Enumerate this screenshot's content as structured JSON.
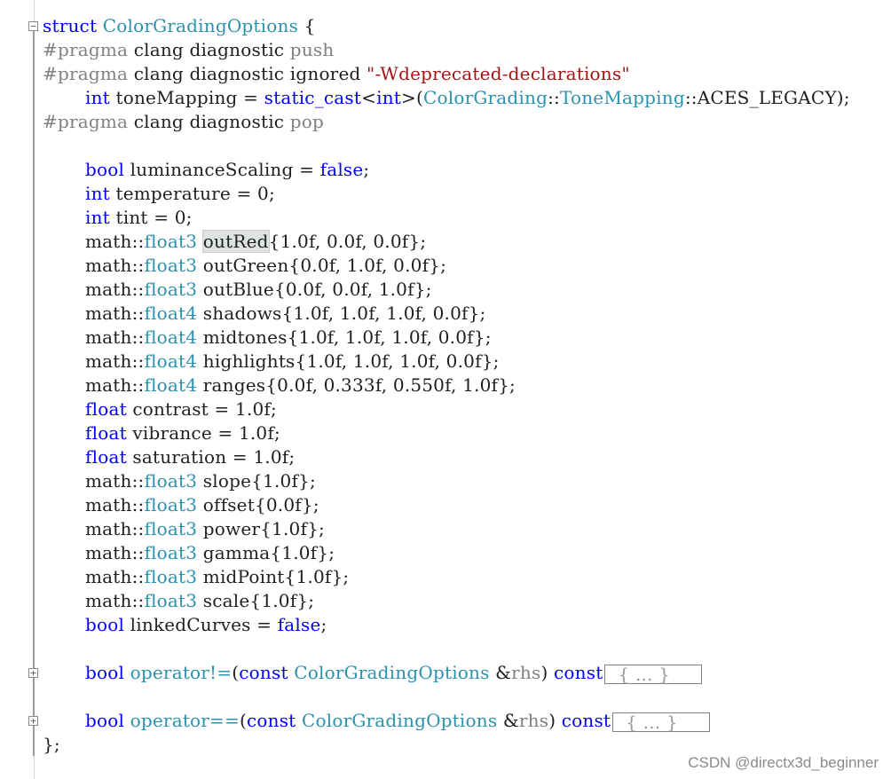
{
  "code": {
    "l1": {
      "kw": "struct",
      "name": "ColorGradingOptions",
      "brace": " {"
    },
    "l2": {
      "pp": "#pragma",
      "rest": " clang diagnostic ",
      "pp2": "push"
    },
    "l3": {
      "pp": "#pragma",
      "rest": " clang diagnostic ignored ",
      "str": "\"-Wdeprecated-declarations\""
    },
    "l4": {
      "kw": "int",
      "a": " toneMapping = ",
      "kw2": "static_cast",
      "b": "<",
      "kw3": "int",
      "c": ">(",
      "t1": "ColorGrading",
      "d": "::",
      "t2": "ToneMapping",
      "e": "::ACES_LEGACY);"
    },
    "l5": {
      "pp": "#pragma",
      "rest": " clang diagnostic ",
      "pp2": "pop"
    },
    "l7": {
      "kw": "bool",
      "a": " luminanceScaling = ",
      "kw2": "false",
      "b": ";"
    },
    "l8": {
      "kw": "int",
      "a": " temperature = 0;"
    },
    "l9": {
      "kw": "int",
      "a": " tint = 0;"
    },
    "l10": {
      "ns": "math::",
      "ty": "float3",
      "sp": " ",
      "hl": "outRed",
      "a": "{1.0f, 0.0f, 0.0f};"
    },
    "l11": {
      "ns": "math::",
      "ty": "float3",
      "a": " outGreen{0.0f, 1.0f, 0.0f};"
    },
    "l12": {
      "ns": "math::",
      "ty": "float3",
      "a": " outBlue{0.0f, 0.0f, 1.0f};"
    },
    "l13": {
      "ns": "math::",
      "ty": "float4",
      "a": " shadows{1.0f, 1.0f, 1.0f, 0.0f};"
    },
    "l14": {
      "ns": "math::",
      "ty": "float4",
      "a": " midtones{1.0f, 1.0f, 1.0f, 0.0f};"
    },
    "l15": {
      "ns": "math::",
      "ty": "float4",
      "a": " highlights{1.0f, 1.0f, 1.0f, 0.0f};"
    },
    "l16": {
      "ns": "math::",
      "ty": "float4",
      "a": " ranges{0.0f, 0.333f, 0.550f, 1.0f};"
    },
    "l17": {
      "kw": "float",
      "a": " contrast = 1.0f;"
    },
    "l18": {
      "kw": "float",
      "a": " vibrance = 1.0f;"
    },
    "l19": {
      "kw": "float",
      "a": " saturation = 1.0f;"
    },
    "l20": {
      "ns": "math::",
      "ty": "float3",
      "a": " slope{1.0f};"
    },
    "l21": {
      "ns": "math::",
      "ty": "float3",
      "a": " offset{0.0f};"
    },
    "l22": {
      "ns": "math::",
      "ty": "float3",
      "a": " power{1.0f};"
    },
    "l23": {
      "ns": "math::",
      "ty": "float3",
      "a": " gamma{1.0f};"
    },
    "l24": {
      "ns": "math::",
      "ty": "float3",
      "a": " midPoint{1.0f};"
    },
    "l25": {
      "ns": "math::",
      "ty": "float3",
      "a": " scale{1.0f};"
    },
    "l26": {
      "kw": "bool",
      "a": " linkedCurves = ",
      "kw2": "false",
      "b": ";"
    },
    "l28": {
      "kw": "bool",
      "sp": " ",
      "op": "operator!=",
      "p1": "(",
      "kw2": "const",
      "sp2": " ",
      "ty": "ColorGradingOptions",
      "p2": " &",
      "arg": "rhs",
      "p3": ") ",
      "kw3": "const",
      "fold": "{ ... }"
    },
    "l30": {
      "kw": "bool",
      "sp": " ",
      "op": "operator==",
      "p1": "(",
      "kw2": "const",
      "sp2": " ",
      "ty": "ColorGradingOptions",
      "p2": " &",
      "arg": "rhs",
      "p3": ") ",
      "kw3": "const",
      "fold": "{ ... }"
    },
    "l31": {
      "a": "};"
    }
  },
  "fold_buttons": {
    "expanded": "−",
    "collapsed": "+"
  },
  "watermark": "CSDN @directx3d_beginner",
  "colors": {
    "keyword": "#0000ff",
    "type": "#2b91af",
    "preprocessor": "#808080",
    "string": "#a31515",
    "text": "#1f1f1f"
  }
}
